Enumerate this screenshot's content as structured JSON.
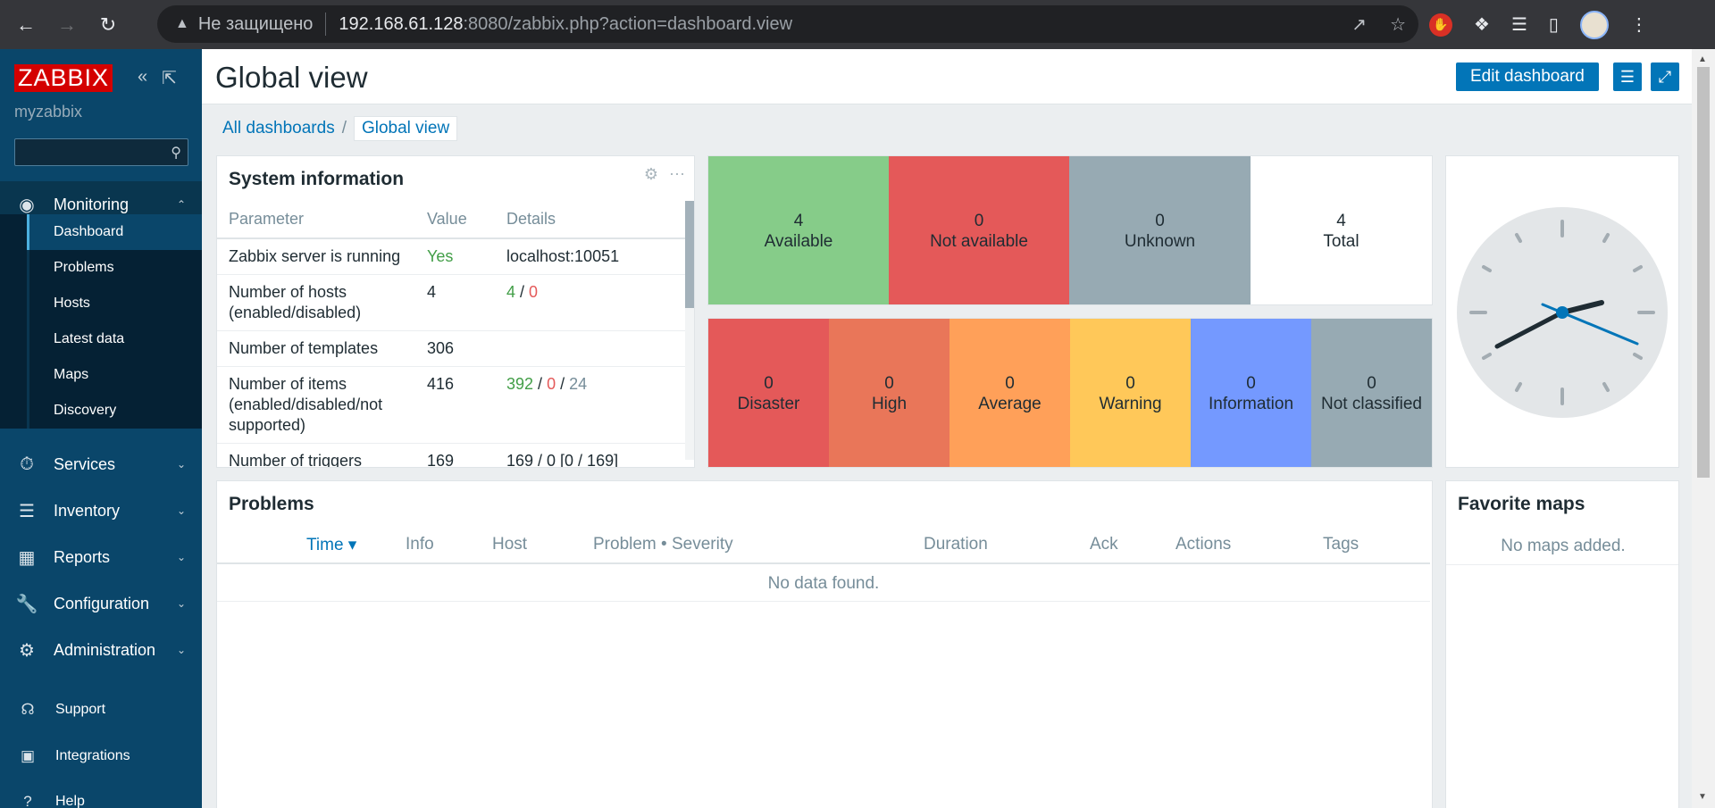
{
  "browser": {
    "warning_text": "Не защищено",
    "url_host": "192.168.61.128",
    "url_rest": ":8080/zabbix.php?action=dashboard.view"
  },
  "sidebar": {
    "logo": "ZABBIX",
    "server_name": "myzabbix",
    "search_placeholder": "",
    "menu": [
      {
        "label": "Monitoring",
        "icon": "eye-icon"
      },
      {
        "label": "Services",
        "icon": "stopwatch-icon"
      },
      {
        "label": "Inventory",
        "icon": "list-icon"
      },
      {
        "label": "Reports",
        "icon": "bar-chart-icon"
      },
      {
        "label": "Configuration",
        "icon": "wrench-icon"
      },
      {
        "label": "Administration",
        "icon": "gear-icon"
      }
    ],
    "submenu": [
      "Dashboard",
      "Problems",
      "Hosts",
      "Latest data",
      "Maps",
      "Discovery"
    ],
    "bottom": [
      {
        "label": "Support",
        "icon": "headset-icon"
      },
      {
        "label": "Integrations",
        "icon": "z-icon"
      },
      {
        "label": "Help",
        "icon": "question-icon"
      }
    ]
  },
  "header": {
    "title": "Global view",
    "edit_label": "Edit dashboard"
  },
  "breadcrumb": [
    "All dashboards",
    "Global view"
  ],
  "system_info": {
    "title": "System information",
    "columns": [
      "Parameter",
      "Value",
      "Details"
    ],
    "rows": [
      {
        "param": "Zabbix server is running",
        "value": "Yes",
        "details": "localhost:10051"
      },
      {
        "param": "Number of hosts (enabled/disabled)",
        "value": "4",
        "d1": "4",
        "s1": " / ",
        "d2": "0"
      },
      {
        "param": "Number of templates",
        "value": "306"
      },
      {
        "param": "Number of items (enabled/disabled/not supported)",
        "value": "416",
        "d1": "392",
        "s1": " / ",
        "d2": "0",
        "s2": " / ",
        "d3": "24"
      },
      {
        "param": "Number of triggers",
        "value": "169",
        "details": "169 / 0 [0 / 169]"
      }
    ]
  },
  "host_availability": [
    {
      "count": "4",
      "label": "Available",
      "color": "#86cc89"
    },
    {
      "count": "0",
      "label": "Not available",
      "color": "#e45959"
    },
    {
      "count": "0",
      "label": "Unknown",
      "color": "#97aab3"
    },
    {
      "count": "4",
      "label": "Total",
      "color": "#ffffff"
    }
  ],
  "problems_by_severity": [
    {
      "count": "0",
      "label": "Disaster",
      "color": "#e45959"
    },
    {
      "count": "0",
      "label": "High",
      "color": "#e97659"
    },
    {
      "count": "0",
      "label": "Average",
      "color": "#ffa059"
    },
    {
      "count": "0",
      "label": "Warning",
      "color": "#ffc859"
    },
    {
      "count": "0",
      "label": "Information",
      "color": "#7499ff"
    },
    {
      "count": "0",
      "label": "Not classified",
      "color": "#97aab3"
    }
  ],
  "problems": {
    "title": "Problems",
    "columns": [
      "Time ▾",
      "Info",
      "Host",
      "Problem • Severity",
      "Duration",
      "Ack",
      "Actions",
      "Tags"
    ],
    "empty": "No data found."
  },
  "favorite_maps": {
    "title": "Favorite maps",
    "empty": "No maps added."
  }
}
